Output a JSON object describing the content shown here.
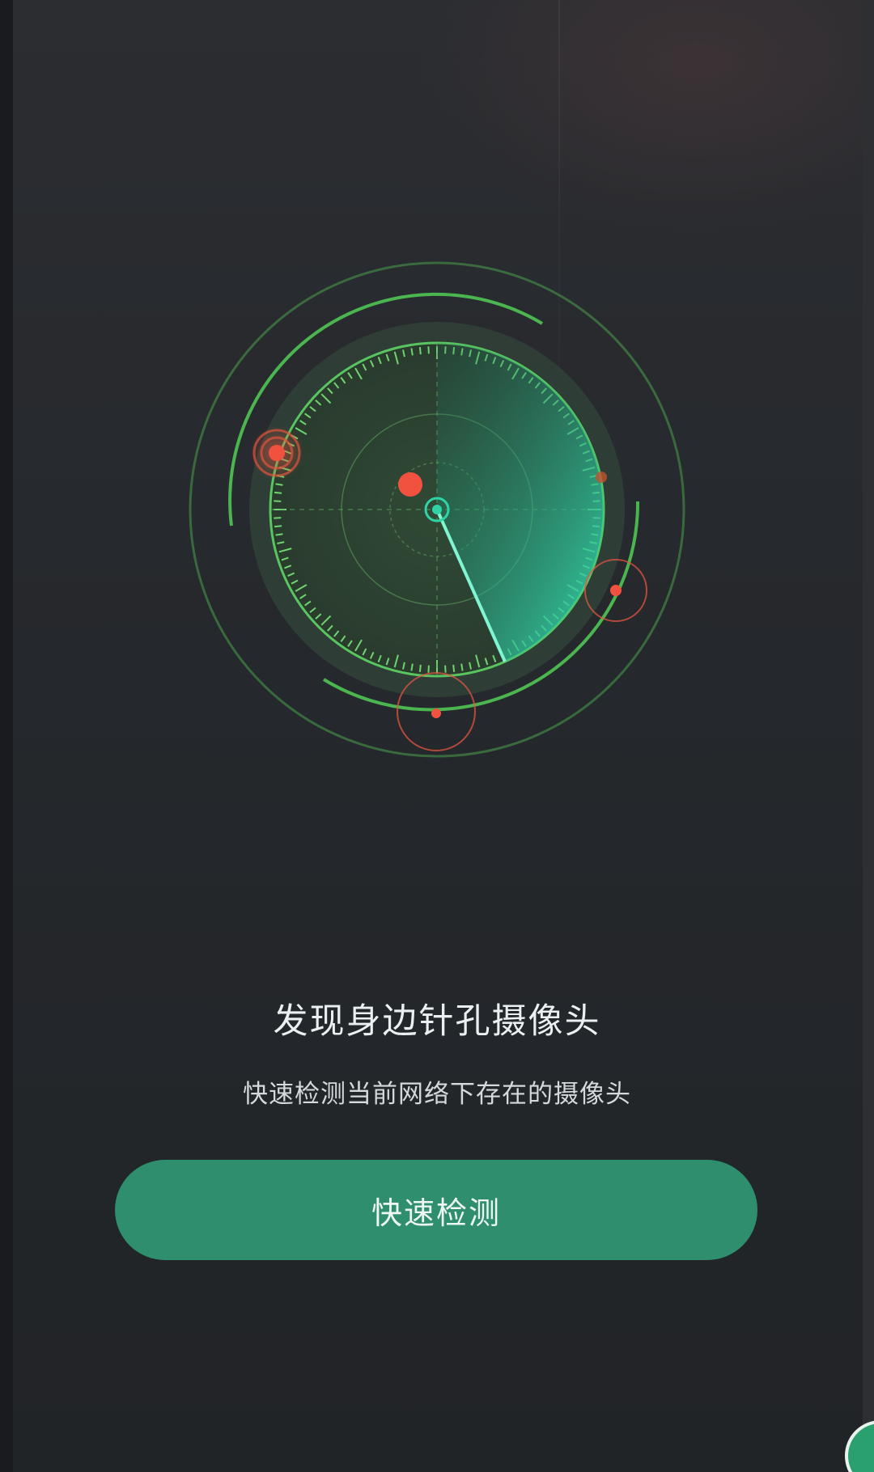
{
  "main": {
    "title": "发现身边针孔摄像头",
    "subtitle": "快速检测当前网络下存在的摄像头",
    "scan_button_label": "快速检测"
  },
  "radar": {
    "icon": "radar-scan-icon",
    "sweep_color": "#2fd3a6",
    "ring_color": "#4fbf5e",
    "target_color": "#f0523f"
  },
  "colors": {
    "background": "#24272b",
    "accent": "#2e8e6e"
  }
}
